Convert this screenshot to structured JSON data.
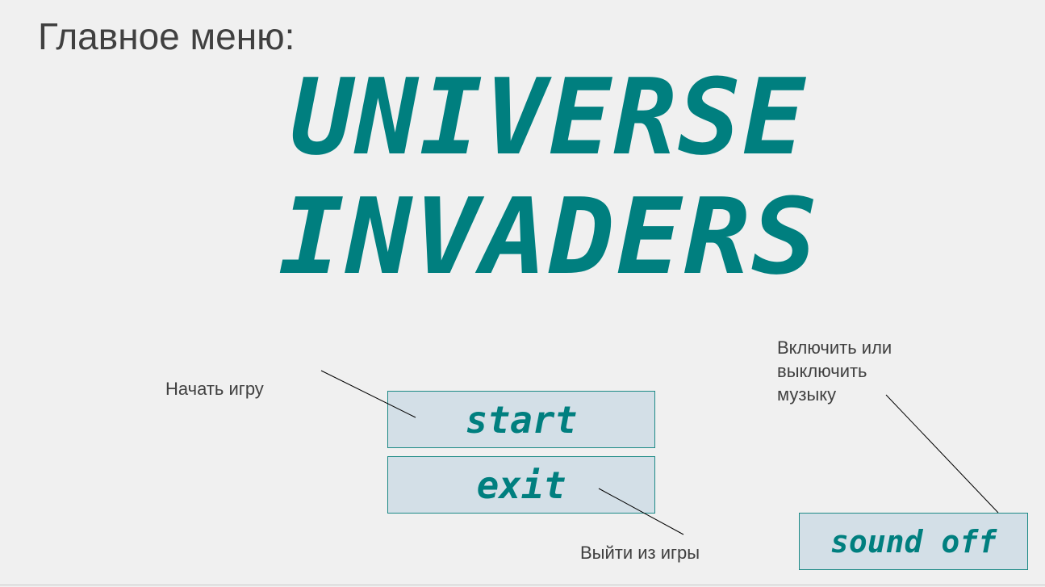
{
  "slide": {
    "title": "Главное меню:"
  },
  "logo": {
    "line1": "UNIVERSE",
    "line2": "INVADERS",
    "color": "#007f7f"
  },
  "buttons": {
    "start_label": "start",
    "exit_label": "exit",
    "sound_label": "sound off",
    "fill": "#d3dfe7",
    "border": "#1d8a86"
  },
  "annotations": {
    "start_note": "Начать игру",
    "exit_note": "Выйти из игры",
    "sound_note_line1": "Включить или",
    "sound_note_line2": "выключить",
    "sound_note_line3": "музыку"
  }
}
